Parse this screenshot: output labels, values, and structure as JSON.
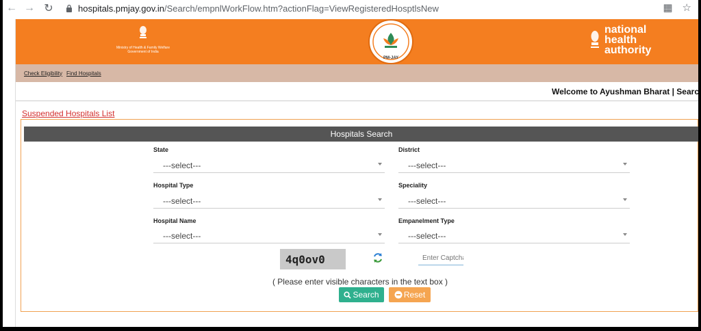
{
  "browser": {
    "url_host": "hospitals.pmjay.gov.in",
    "url_path": "/Search/empnlWorkFlow.htm?actionFlag=ViewRegisteredHosptlsNew"
  },
  "header": {
    "ministry_line1": "Ministry of Health & Family Welfare",
    "ministry_line2": "Government of India",
    "pmjay_tag": "PM-JAY",
    "nha_line1": "national",
    "nha_line2": "health",
    "nha_line3": "authority",
    "brand_color": "#f47e20"
  },
  "subnav": {
    "check_eligibility": "Check Eligibility",
    "find_hospitals": "Find Hospitals"
  },
  "welcome": "Welcome to Ayushman Bharat | Searc",
  "suspended_link": "Suspended Hospitals List",
  "search_panel": {
    "title": "Hospitals Search",
    "fields": {
      "state": {
        "label": "State",
        "value": "---select---"
      },
      "district": {
        "label": "District",
        "value": "---select---"
      },
      "hospital_type": {
        "label": "Hospital Type",
        "value": "---select---"
      },
      "speciality": {
        "label": "Speciality",
        "value": "---select---"
      },
      "hospital_name": {
        "label": "Hospital Name",
        "value": "---select---"
      },
      "empanelment_type": {
        "label": "Empanelment Type",
        "value": "---select---"
      }
    },
    "captcha_text": "4q0ov0",
    "captcha_placeholder": "Enter Captcha",
    "hint": "( Please enter visible characters in the text box )",
    "search_label": "Search",
    "reset_label": "Reset"
  }
}
